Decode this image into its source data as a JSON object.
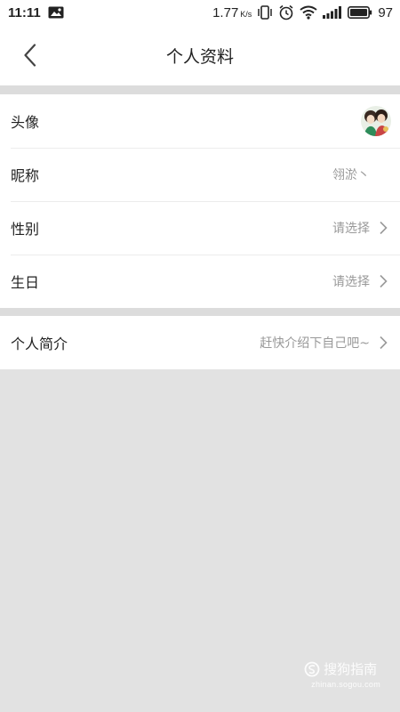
{
  "status_bar": {
    "time": "11:11",
    "speed": "1.77",
    "speed_unit": "K/s",
    "battery": "97",
    "icons": [
      "image-notification-icon",
      "vibrate-icon",
      "alarm-icon",
      "wifi-icon",
      "signal-icon",
      "battery-icon"
    ]
  },
  "header": {
    "back_icon": "chevron-left-icon",
    "title": "个人资料"
  },
  "profile": {
    "rows": [
      {
        "label": "头像",
        "value": "",
        "type": "avatar"
      },
      {
        "label": "昵称",
        "value": "翎淤丶",
        "type": "text"
      },
      {
        "label": "性别",
        "value": "请选择",
        "type": "select"
      },
      {
        "label": "生日",
        "value": "请选择",
        "type": "select"
      }
    ],
    "bio": {
      "label": "个人简介",
      "value": "赶快介绍下自己吧~"
    }
  },
  "watermark": {
    "main": "搜狗指南",
    "sub": "zhinan.sogou.com"
  },
  "colors": {
    "background": "#e2e2e2",
    "surface": "#ffffff",
    "text": "#222222",
    "muted": "#999999"
  }
}
